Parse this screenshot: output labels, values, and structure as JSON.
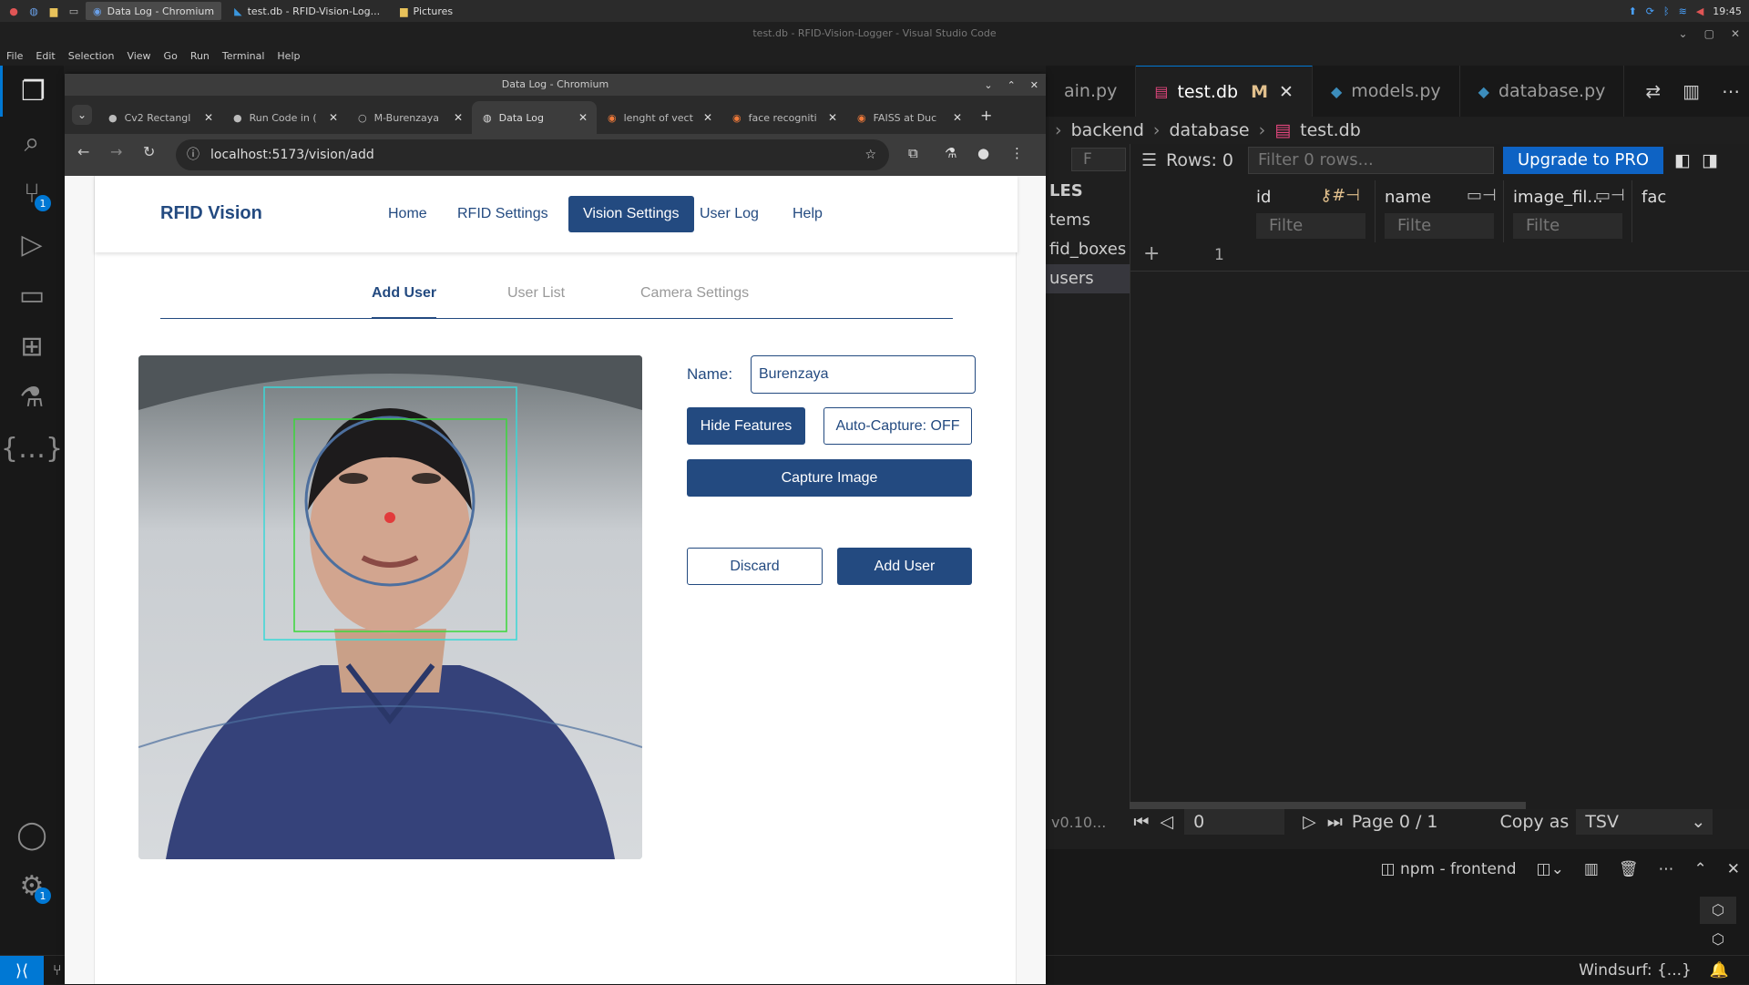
{
  "taskbar": {
    "tasks": [
      {
        "label": "Data Log - Chromium",
        "active": true
      },
      {
        "label": "test.db - RFID-Vision-Log...",
        "active": false
      },
      {
        "label": "Pictures",
        "active": false
      }
    ],
    "clock": "19:45"
  },
  "vscode": {
    "title": "test.db - RFID-Vision-Logger - Visual Studio Code",
    "menu": [
      "File",
      "Edit",
      "Selection",
      "View",
      "Go",
      "Run",
      "Terminal",
      "Help"
    ],
    "activity": {
      "scm_badge": "1",
      "settings_badge": "1"
    },
    "tabs": [
      {
        "label": "ain.py",
        "modified": "",
        "active": false
      },
      {
        "label": "test.db",
        "modified": "M",
        "active": true
      },
      {
        "label": "models.py",
        "modified": "",
        "active": false
      },
      {
        "label": "database.py",
        "modified": "",
        "active": false
      }
    ],
    "breadcrumb": [
      "backend",
      "database",
      "test.db"
    ],
    "db": {
      "sidebar_header": "LES",
      "tables": [
        "tems",
        "fid_boxes",
        "users"
      ],
      "selected_table": "users",
      "version": "v0.10...",
      "filter_tab": "F",
      "rows_label": "Rows: 0",
      "filter_placeholder": "Filter 0 rows...",
      "upgrade_label": "Upgrade to PRO",
      "columns": [
        {
          "name": "id",
          "filter": "Filte"
        },
        {
          "name": "name",
          "filter": "Filte"
        },
        {
          "name": "image_fil...",
          "filter": "Filte"
        },
        {
          "name": "fac",
          "filter": ""
        }
      ],
      "add_row_number": "1",
      "page_input": "0",
      "page_label": "Page 0 / 1",
      "copy_as_label": "Copy as",
      "copy_format": "TSV"
    },
    "panel": {
      "terminal_label": "npm - frontend"
    },
    "status": {
      "right": "Windsurf: {...}"
    }
  },
  "chromium": {
    "window_title": "Data Log - Chromium",
    "tabs": [
      {
        "label": "Cv2 Rectangl",
        "active": false
      },
      {
        "label": "Run Code in (",
        "active": false
      },
      {
        "label": "M-Burenzaya",
        "active": false
      },
      {
        "label": "Data Log",
        "active": true
      },
      {
        "label": "lenght of vect",
        "active": false
      },
      {
        "label": "face recogniti",
        "active": false
      },
      {
        "label": "FAISS at Duc",
        "active": false
      }
    ],
    "url": "localhost:5173/vision/add"
  },
  "app": {
    "brand": "RFID Vision",
    "nav": [
      {
        "label": "Home",
        "active": false
      },
      {
        "label": "RFID Settings",
        "active": false
      },
      {
        "label": "Vision Settings",
        "active": true
      },
      {
        "label": "User Log",
        "active": false
      },
      {
        "label": "Help",
        "active": false
      }
    ],
    "subtabs": [
      {
        "label": "Add User",
        "active": true
      },
      {
        "label": "User List",
        "active": false
      },
      {
        "label": "Camera Settings",
        "active": false
      }
    ],
    "form": {
      "name_label": "Name:",
      "name_value": "Burenzaya",
      "hide_features_label": "Hide Features",
      "auto_capture_label": "Auto-Capture: OFF",
      "capture_label": "Capture Image",
      "discard_label": "Discard",
      "add_user_label": "Add User"
    },
    "colors": {
      "primary": "#234a80",
      "accent": "#0078d4"
    }
  }
}
